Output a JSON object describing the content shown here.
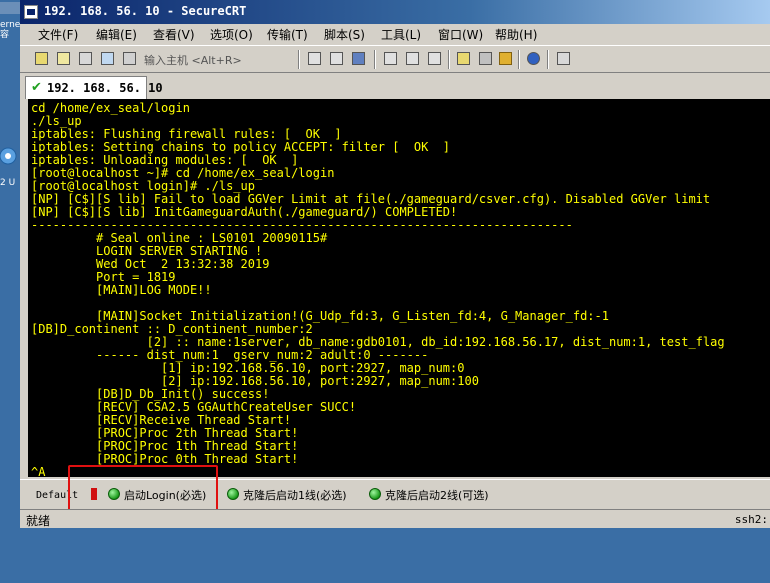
{
  "desktop": {
    "icon1_label": "erne\n容",
    "icon2_label": "2 U"
  },
  "window": {
    "title": "192. 168. 56. 10 - SecureCRT"
  },
  "menu": [
    "文件(F)",
    "编辑(E)",
    "查看(V)",
    "选项(O)",
    "传输(T)",
    "脚本(S)",
    "工具(L)",
    "窗口(W)",
    "帮助(H)"
  ],
  "toolbar": {
    "host_input_placeholder": "输入主机 <Alt+R>"
  },
  "tab": {
    "label": "192. 168. 56. 10"
  },
  "terminal_lines": [
    "cd /home/ex_seal/login",
    "./ls_up",
    "iptables: Flushing firewall rules: [  OK  ]",
    "iptables: Setting chains to policy ACCEPT: filter [  OK  ]",
    "iptables: Unloading modules: [  OK  ]",
    "[root@localhost ~]# cd /home/ex_seal/login",
    "[root@localhost login]# ./ls_up",
    "[NP] [C$][S lib] Fail to load GGVer Limit at file(./gameguard/csver.cfg). Disabled GGVer limit",
    "[NP] [C$][S lib] InitGameguardAuth(./gameguard/) COMPLETED!",
    "---------------------------------------------------------------------------",
    "         # Seal online : LS0101 20090115#",
    "         LOGIN SERVER STARTING !",
    "         Wed Oct  2 13:32:38 2019",
    "         Port = 1819",
    "         [MAIN]LOG MODE!!",
    "",
    "         [MAIN]Socket Initialization!(G_Udp_fd:3, G_Listen_fd:4, G_Manager_fd:-1",
    "[DB]D_continent :: D_continent_number:2",
    "                [2] :: name:1server, db_name:gdb0101, db_id:192.168.56.17, dist_num:1, test_flag",
    "         ------ dist_num:1  gserv_num:2 adult:0 -------",
    "                  [1] ip:192.168.56.10, port:2927, map_num:0",
    "                  [2] ip:192.168.56.10, port:2927, map_num:100",
    "         [DB]D_Db_Init() success!",
    "         [RECV] CSA2.5 GGAuthCreateUser SUCC!",
    "         [RECV]Receive Thread Start!",
    "         [PROC]Proc 2th Thread Start!",
    "         [PROC]Proc 1th Thread Start!",
    "         [PROC]Proc 0th Thread Start!",
    "^A"
  ],
  "buttonbar": {
    "default_label": "Default",
    "buttons": [
      "启动Login(必选)",
      "克隆后启动1线(必选)",
      "克隆后启动2线(可选)"
    ]
  },
  "status": {
    "left": "就绪",
    "right": "ssh2:"
  },
  "colors": {
    "terminal_bg": "#000000",
    "terminal_fg": "#ffff00",
    "highlight": "#e01010"
  }
}
